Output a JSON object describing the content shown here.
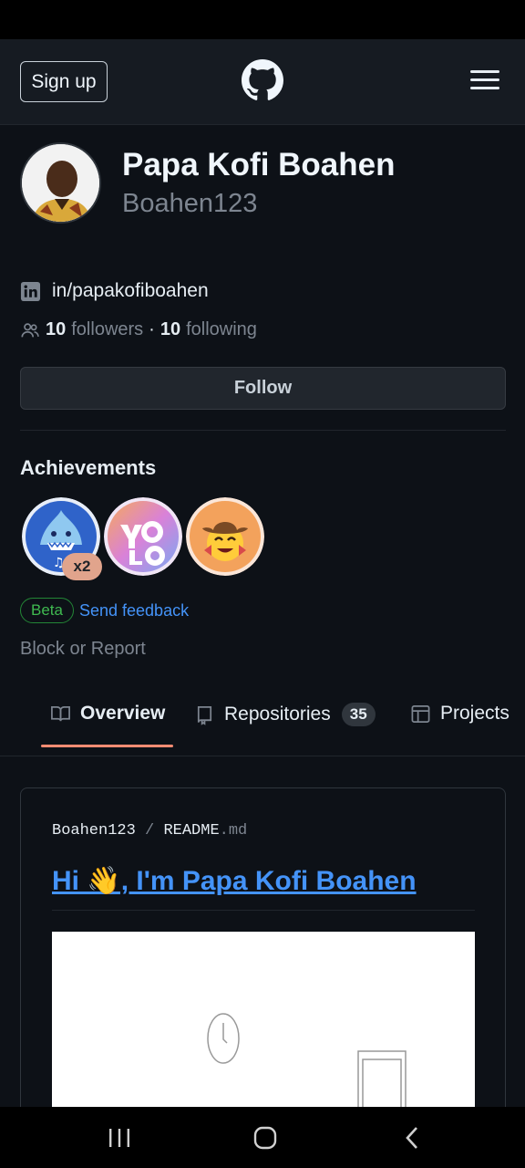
{
  "header": {
    "signup_label": "Sign up"
  },
  "profile": {
    "full_name": "Papa Kofi Boahen",
    "username": "Boahen123",
    "social_link": "in/papakofiboahen",
    "followers_count": "10",
    "followers_label": "followers",
    "separator": "·",
    "following_count": "10",
    "following_label": "following",
    "follow_button": "Follow"
  },
  "achievements": {
    "title": "Achievements",
    "badges": [
      {
        "name": "shark-badge",
        "count": "x2"
      },
      {
        "name": "yolo-badge"
      },
      {
        "name": "cowboy-badge"
      }
    ],
    "beta_label": "Beta",
    "feedback_label": "Send feedback"
  },
  "block_report": "Block or Report",
  "tabs": [
    {
      "label": "Overview",
      "active": true
    },
    {
      "label": "Repositories",
      "count": "35"
    },
    {
      "label": "Projects"
    }
  ],
  "readme": {
    "owner": "Boahen123",
    "slash": "/",
    "file_base": "README",
    "file_ext": ".md",
    "heading": "Hi 👋, I'm Papa Kofi Boahen"
  },
  "colors": {
    "background": "#0d1117",
    "header": "#161b22",
    "accent_link": "#4493f8",
    "tab_underline": "#fd8c73",
    "beta_green": "#3fb950"
  }
}
